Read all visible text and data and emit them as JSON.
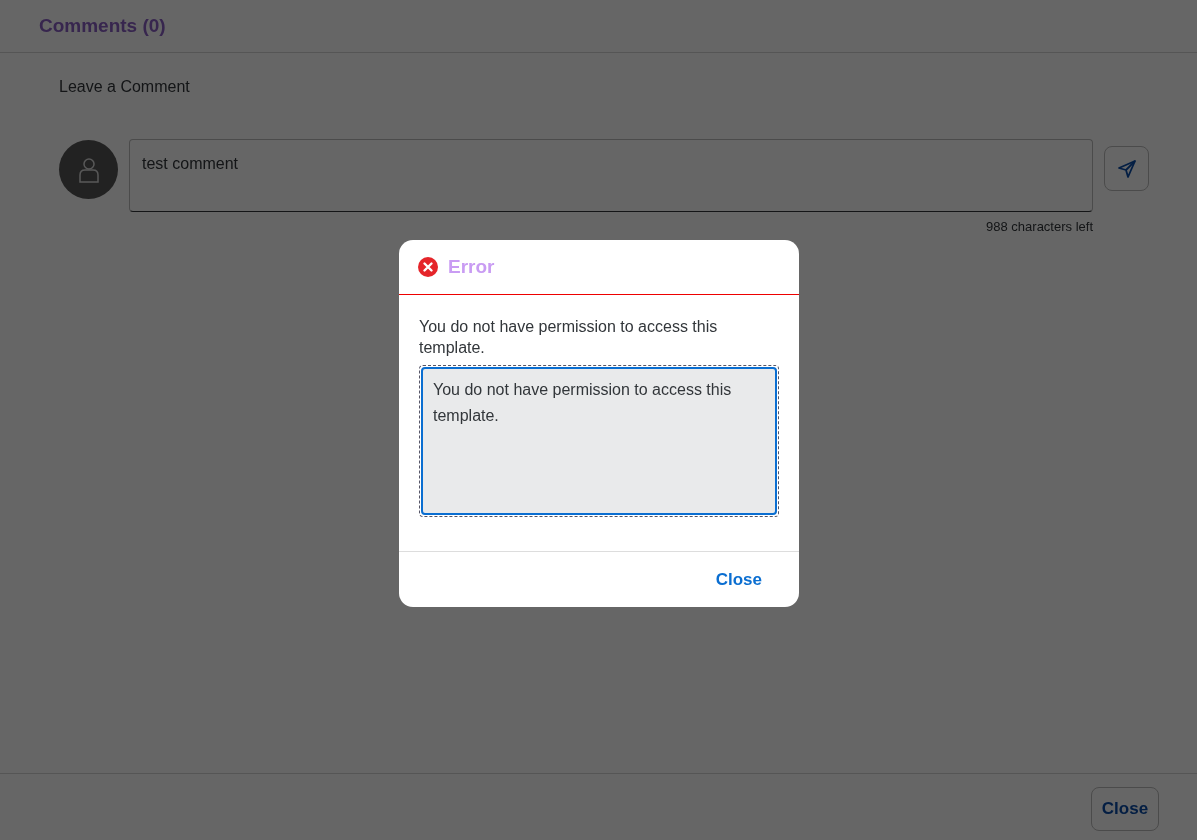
{
  "panel": {
    "title": "Comments (0)",
    "section_label": "Leave a Comment",
    "comment_field": {
      "value": "test comment"
    },
    "characters_left": "988 characters left",
    "footer_button": "Close"
  },
  "error_dialog": {
    "title": "Error",
    "message": "You do not have permission to access this template.",
    "details": "You do not have permission to access this template.",
    "button": "Close"
  }
}
